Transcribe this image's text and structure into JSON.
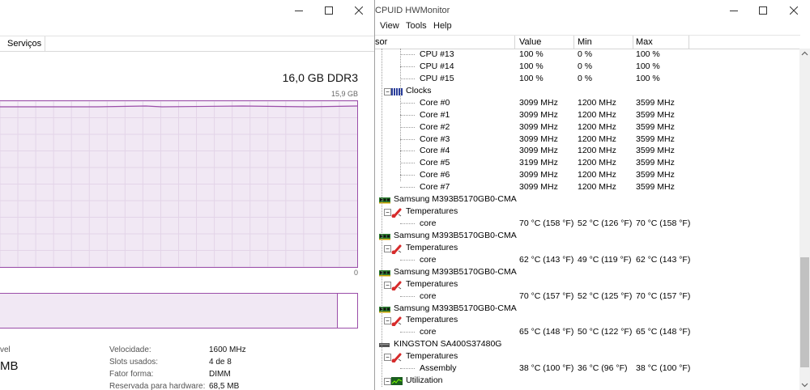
{
  "task_manager": {
    "tab_label": "Serviços",
    "memory_total": "16,0 GB DDR3",
    "graph_max": "15,9 GB",
    "graph_min": "0",
    "partial_left_label": "vel",
    "partial_left_value": "MB",
    "stats": [
      {
        "label": "Velocidade:",
        "value": "1600 MHz"
      },
      {
        "label": "Slots usados:",
        "value": "4 de 8"
      },
      {
        "label": "Fator forma:",
        "value": "DIMM"
      },
      {
        "label": "Reservada para hardware:",
        "value": "68,5 MB"
      }
    ]
  },
  "hwmonitor": {
    "title": "CPUID HWMonitor",
    "menu": [
      "View",
      "Tools",
      "Help"
    ],
    "columns": {
      "sensor": "sor",
      "value": "Value",
      "min": "Min",
      "max": "Max"
    },
    "rows": [
      {
        "level": 3,
        "label": "CPU #13",
        "value": "100 %",
        "min": "0 %",
        "max": "100 %"
      },
      {
        "level": 3,
        "label": "CPU #14",
        "value": "100 %",
        "min": "0 %",
        "max": "100 %"
      },
      {
        "level": 3,
        "label": "CPU #15",
        "value": "100 %",
        "min": "0 %",
        "max": "100 %"
      },
      {
        "level": 2,
        "label": "Clocks",
        "icon": "clocks-icon",
        "expander": "−",
        "value": "",
        "min": "",
        "max": ""
      },
      {
        "level": 3,
        "label": "Core #0",
        "value": "3099 MHz",
        "min": "1200 MHz",
        "max": "3599 MHz"
      },
      {
        "level": 3,
        "label": "Core #1",
        "value": "3099 MHz",
        "min": "1200 MHz",
        "max": "3599 MHz"
      },
      {
        "level": 3,
        "label": "Core #2",
        "value": "3099 MHz",
        "min": "1200 MHz",
        "max": "3599 MHz"
      },
      {
        "level": 3,
        "label": "Core #3",
        "value": "3099 MHz",
        "min": "1200 MHz",
        "max": "3599 MHz"
      },
      {
        "level": 3,
        "label": "Core #4",
        "value": "3099 MHz",
        "min": "1200 MHz",
        "max": "3599 MHz"
      },
      {
        "level": 3,
        "label": "Core #5",
        "value": "3199 MHz",
        "min": "1200 MHz",
        "max": "3599 MHz"
      },
      {
        "level": 3,
        "label": "Core #6",
        "value": "3099 MHz",
        "min": "1200 MHz",
        "max": "3599 MHz"
      },
      {
        "level": 3,
        "label": "Core #7",
        "value": "3099 MHz",
        "min": "1200 MHz",
        "max": "3599 MHz"
      },
      {
        "level": 1,
        "label": "Samsung M393B5170GB0-CMA",
        "icon": "memory-module-icon",
        "value": "",
        "min": "",
        "max": ""
      },
      {
        "level": 2,
        "label": "Temperatures",
        "icon": "thermometer-icon",
        "expander": "−",
        "value": "",
        "min": "",
        "max": ""
      },
      {
        "level": 3,
        "label": "core",
        "value": "70 °C  (158 °F)",
        "min": "52 °C  (126 °F)",
        "max": "70 °C  (158 °F)"
      },
      {
        "level": 1,
        "label": "Samsung M393B5170GB0-CMA",
        "icon": "memory-module-icon",
        "value": "",
        "min": "",
        "max": ""
      },
      {
        "level": 2,
        "label": "Temperatures",
        "icon": "thermometer-icon",
        "expander": "−",
        "value": "",
        "min": "",
        "max": ""
      },
      {
        "level": 3,
        "label": "core",
        "value": "62 °C  (143 °F)",
        "min": "49 °C  (119 °F)",
        "max": "62 °C  (143 °F)"
      },
      {
        "level": 1,
        "label": "Samsung M393B5170GB0-CMA",
        "icon": "memory-module-icon",
        "value": "",
        "min": "",
        "max": ""
      },
      {
        "level": 2,
        "label": "Temperatures",
        "icon": "thermometer-icon",
        "expander": "−",
        "value": "",
        "min": "",
        "max": ""
      },
      {
        "level": 3,
        "label": "core",
        "value": "70 °C  (157 °F)",
        "min": "52 °C  (125 °F)",
        "max": "70 °C  (157 °F)"
      },
      {
        "level": 1,
        "label": "Samsung M393B5170GB0-CMA",
        "icon": "memory-module-icon",
        "value": "",
        "min": "",
        "max": ""
      },
      {
        "level": 2,
        "label": "Temperatures",
        "icon": "thermometer-icon",
        "expander": "−",
        "value": "",
        "min": "",
        "max": ""
      },
      {
        "level": 3,
        "label": "core",
        "value": "65 °C  (148 °F)",
        "min": "50 °C  (122 °F)",
        "max": "65 °C  (148 °F)"
      },
      {
        "level": 1,
        "label": "KINGSTON SA400S37480G",
        "icon": "drive-icon",
        "value": "",
        "min": "",
        "max": ""
      },
      {
        "level": 2,
        "label": "Temperatures",
        "icon": "thermometer-icon",
        "expander": "−",
        "value": "",
        "min": "",
        "max": ""
      },
      {
        "level": 3,
        "label": "Assembly",
        "value": "38 °C  (100 °F)",
        "min": "36 °C  (96 °F)",
        "max": "38 °C  (100 °F)"
      },
      {
        "level": 2,
        "label": "Utilization",
        "icon": "utilization-icon",
        "expander": "−",
        "value": "",
        "min": "",
        "max": ""
      }
    ]
  },
  "colors": {
    "memory_accent": "#9b4ea9",
    "graph_fill": "#f1e8f4",
    "thermometer": "#d62b2b",
    "module_green": "#2e7d32"
  }
}
